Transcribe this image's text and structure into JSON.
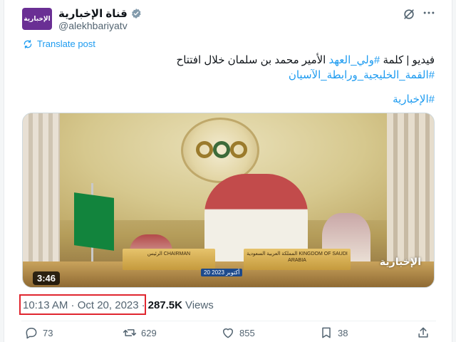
{
  "account": {
    "display_name": "قناة الإخبارية",
    "handle": "@alekhbariyatv",
    "avatar_text": "الإخبارية",
    "verified": true
  },
  "header": {
    "grok_icon": "grok-icon",
    "more_icon": "more-icon"
  },
  "translate": {
    "label": "Translate post",
    "icon": "translate-icon"
  },
  "tweet": {
    "line1_prefix": "فيديو | كلمة ",
    "line1_tag": "#ولي_العهد",
    "line1_rest": " الأمير محمد بن سلمان خلال افتتاح",
    "line2_tag": "#القمة_الخليجية_ورابطة_الآسيان",
    "line3_tag": "#الإخبارية"
  },
  "media": {
    "duration": "3:46",
    "plate_left": "الرئيس CHAIRMAN",
    "plate_right": "المملكة العربية السعودية KINGDOM OF SAUDI ARABIA",
    "ticker_date": "20 أكتوبر 2023",
    "channel_watermark": "الإخبارية"
  },
  "meta": {
    "time": "10:13 AM · Oct 20, 2023",
    "separator": "·",
    "views_count": "287.5K",
    "views_label": "Views",
    "highlight_color": "#e0262f"
  },
  "actions": {
    "replies": "73",
    "reposts": "629",
    "likes": "855",
    "bookmarks": "38"
  },
  "colors": {
    "link": "#1d9bf0",
    "secondary_text": "#536471",
    "avatar_bg": "#6a2f94"
  }
}
